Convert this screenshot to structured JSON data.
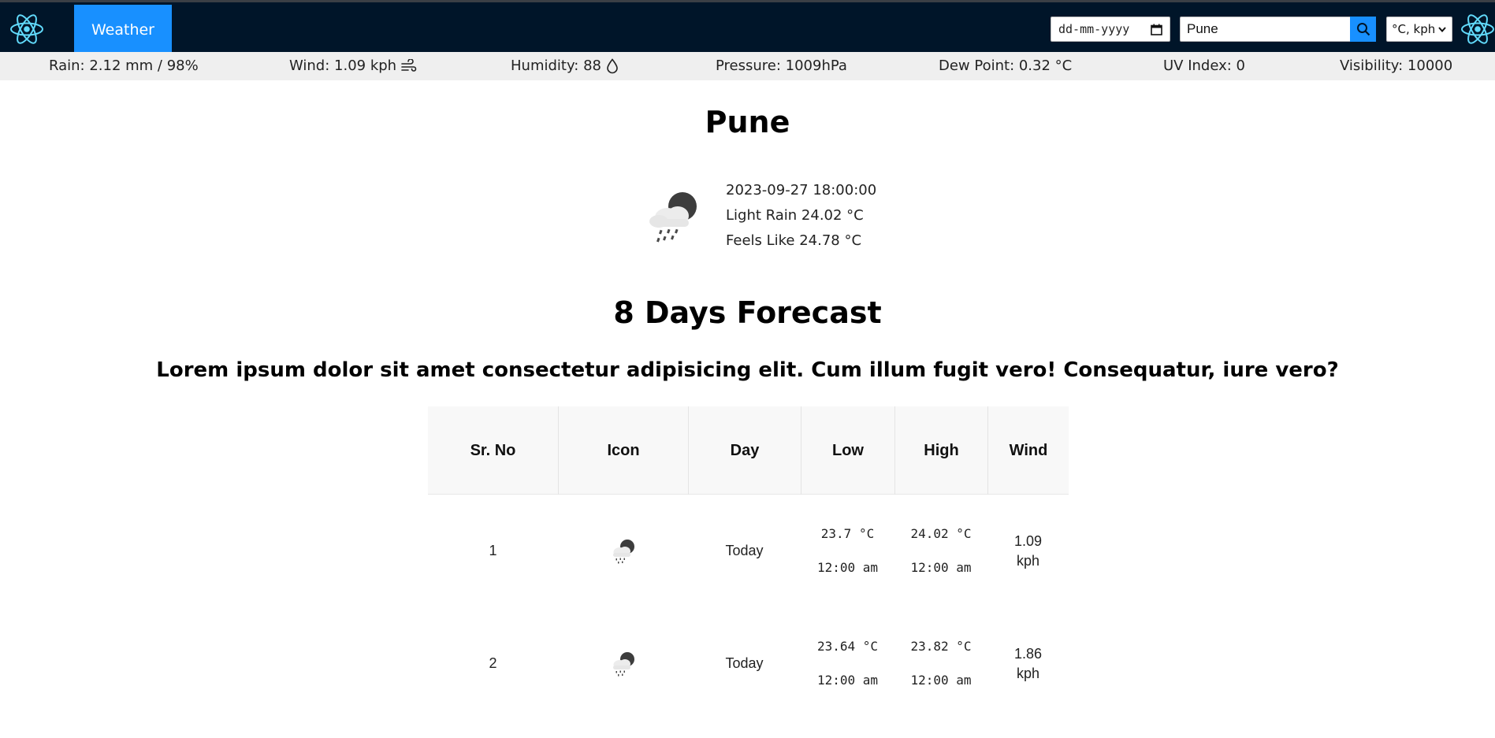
{
  "header": {
    "nav_item": "Weather",
    "date_placeholder": "dd-mm-yyyy",
    "search_value": "Pune",
    "unit_value": "°C, kph"
  },
  "stats": {
    "rain": "Rain: 2.12 mm / 98%",
    "wind": "Wind: 1.09 kph",
    "humidity": "Humidity: 88",
    "pressure": "Pressure: 1009hPa",
    "dew_point": "Dew Point: 0.32 °C",
    "uv_index": "UV Index: 0",
    "visibility": "Visibility: 10000"
  },
  "current": {
    "city": "Pune",
    "datetime": "2023-09-27 18:00:00",
    "condition": "Light Rain 24.02 °C",
    "feels_like": "Feels Like 24.78 °C",
    "icon": "night-rain-cloud-icon"
  },
  "forecast": {
    "title": "8 Days Forecast",
    "subtitle": "Lorem ipsum dolor sit amet consectetur adipisicing elit. Cum illum fugit vero! Consequatur, iure vero?",
    "columns": [
      "Sr. No",
      "Icon",
      "Day",
      "Low",
      "High",
      "Wind"
    ],
    "rows": [
      {
        "sr": "1",
        "icon": "night-rain-cloud-icon",
        "day": "Today",
        "low": "23.7 °C",
        "low_time": "12:00 am",
        "high": "24.02 °C",
        "high_time": "12:00 am",
        "wind_value": "1.09",
        "wind_unit": "kph"
      },
      {
        "sr": "2",
        "icon": "night-rain-cloud-icon",
        "day": "Today",
        "low": "23.64 °C",
        "low_time": "12:00 am",
        "high": "23.82 °C",
        "high_time": "12:00 am",
        "wind_value": "1.86",
        "wind_unit": "kph"
      }
    ]
  },
  "colors": {
    "header_bg": "#001529",
    "accent": "#1890ff",
    "stats_bg": "#efefef",
    "react_logo": "#61dafb"
  }
}
